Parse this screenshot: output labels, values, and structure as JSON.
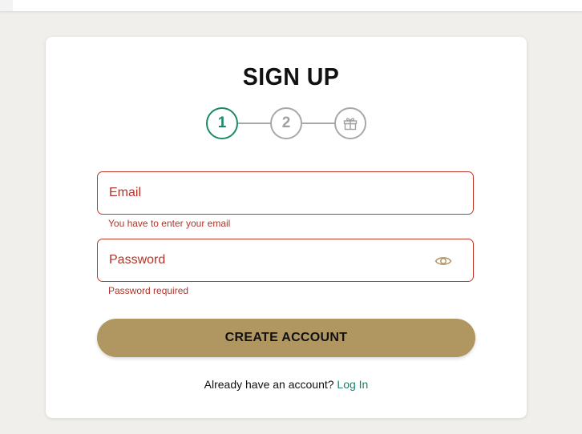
{
  "page": {
    "title": "SIGN UP"
  },
  "stepper": {
    "steps": [
      {
        "label": "1",
        "state": "active"
      },
      {
        "label": "2",
        "state": "inactive"
      },
      {
        "label": "",
        "icon": "gift-icon",
        "state": "inactive"
      }
    ],
    "active_color": "#1a8a6a",
    "inactive_color": "#a8a8a8"
  },
  "form": {
    "email": {
      "placeholder": "Email",
      "value": "",
      "error": "You have to enter your email"
    },
    "password": {
      "placeholder": "Password",
      "value": "",
      "error": "Password required",
      "toggle_icon": "eye-icon"
    },
    "submit_label": "CREATE ACCOUNT",
    "error_color": "#c0392b",
    "button_color": "#b09660"
  },
  "footer": {
    "prompt": "Already have an account?",
    "login_label": "Log In",
    "link_color": "#1a7f6a"
  }
}
